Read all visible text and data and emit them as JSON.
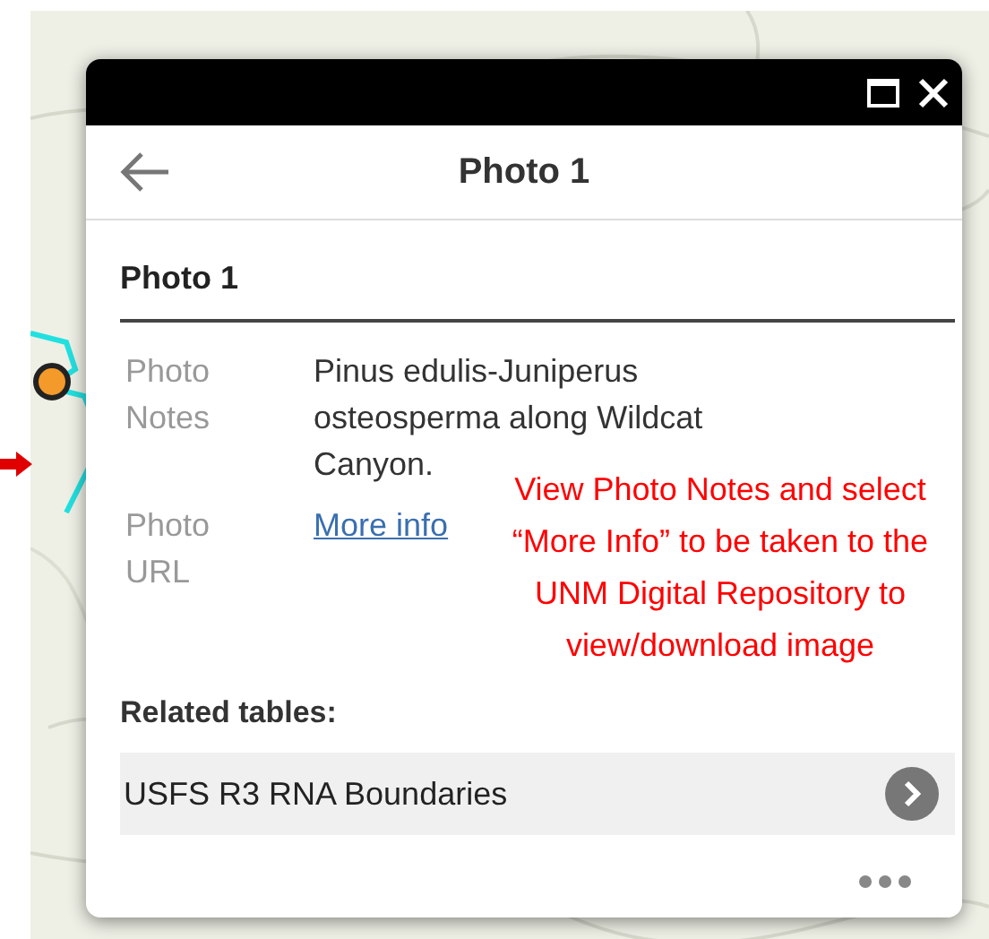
{
  "popup": {
    "title": "Photo 1",
    "heading": "Photo 1",
    "fields": [
      {
        "label": "Photo Notes",
        "value": "Pinus edulis-Juniperus osteosperma along Wildcat Canyon.",
        "kind": "text"
      },
      {
        "label": "Photo URL",
        "value": "More info",
        "kind": "link"
      }
    ],
    "related_label": "Related tables:",
    "related": [
      {
        "name": "USFS R3 RNA Boundaries"
      }
    ]
  },
  "annotation": "View Photo Notes and select “More Info” to be taken to the UNM Digital Repository to view/download image"
}
